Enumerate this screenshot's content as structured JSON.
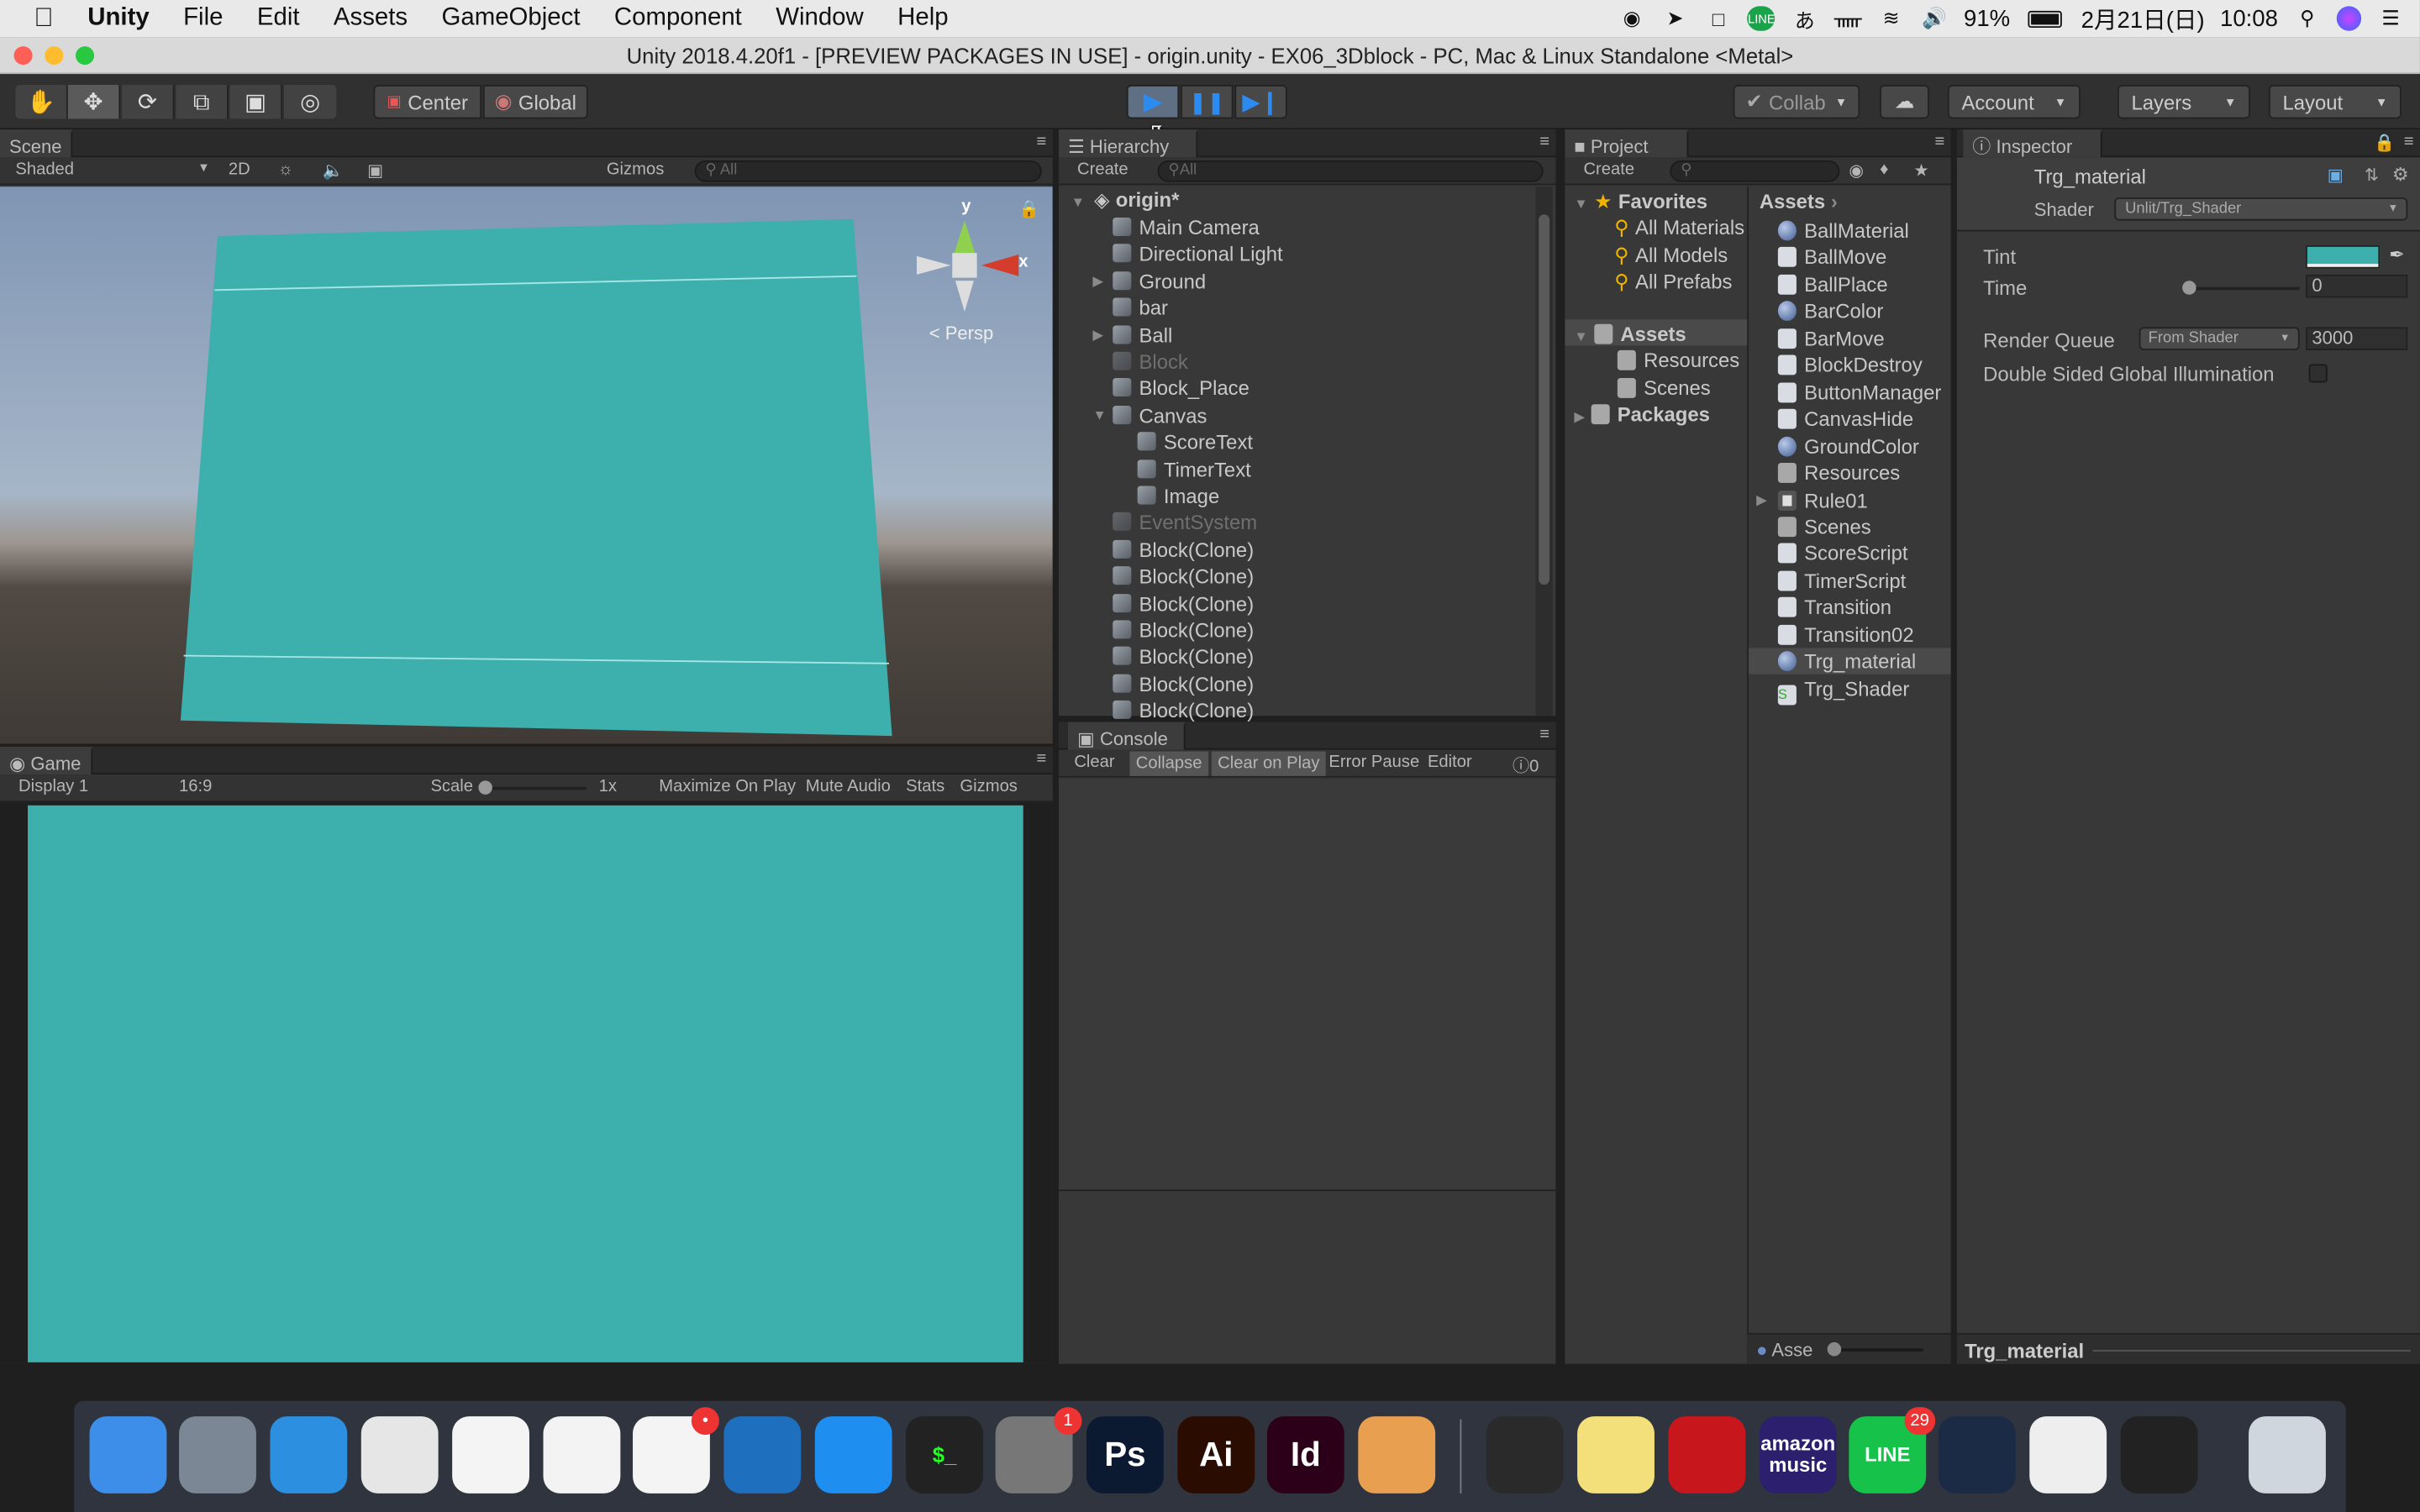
{
  "menubar": {
    "app": "Unity",
    "items": [
      "File",
      "Edit",
      "Assets",
      "GameObject",
      "Component",
      "Window",
      "Help"
    ],
    "battery": "91%",
    "date": "2月21日(日)",
    "time": "10:08",
    "ime": "あ"
  },
  "window": {
    "title": "Unity 2018.4.20f1 - [PREVIEW PACKAGES IN USE] - origin.unity - EX06_3Dblock - PC, Mac & Linux Standalone <Metal>"
  },
  "toolbar": {
    "center": "Center",
    "global": "Global",
    "collab": "Collab",
    "account": "Account",
    "layers": "Layers",
    "layout": "Layout"
  },
  "scene": {
    "tab": "Scene",
    "shading": "Shaded",
    "mode2d": "2D",
    "gizmos": "Gizmos",
    "search_placeholder": "All",
    "persp": "< Persp",
    "axis_y": "y",
    "axis_x": "x"
  },
  "game": {
    "tab": "Game",
    "display": "Display 1",
    "aspect": "16:9",
    "scale_label": "Scale",
    "scale_value": "1x",
    "maximize": "Maximize On Play",
    "mute": "Mute Audio",
    "stats": "Stats",
    "gizmos": "Gizmos"
  },
  "hierarchy": {
    "tab": "Hierarchy",
    "create": "Create",
    "search_placeholder": "All",
    "scene": "origin*",
    "items": [
      {
        "label": "Main Camera",
        "depth": 0,
        "arrow": false,
        "dim": false
      },
      {
        "label": "Directional Light",
        "depth": 0,
        "arrow": false,
        "dim": false
      },
      {
        "label": "Ground",
        "depth": 0,
        "arrow": true,
        "open": false,
        "dim": false
      },
      {
        "label": "bar",
        "depth": 0,
        "arrow": false,
        "dim": false
      },
      {
        "label": "Ball",
        "depth": 0,
        "arrow": true,
        "open": false,
        "dim": false
      },
      {
        "label": "Block",
        "depth": 0,
        "arrow": false,
        "dim": true
      },
      {
        "label": "Block_Place",
        "depth": 0,
        "arrow": false,
        "dim": false
      },
      {
        "label": "Canvas",
        "depth": 0,
        "arrow": true,
        "open": true,
        "dim": false
      },
      {
        "label": "ScoreText",
        "depth": 1,
        "arrow": false,
        "dim": false
      },
      {
        "label": "TimerText",
        "depth": 1,
        "arrow": false,
        "dim": false
      },
      {
        "label": "Image",
        "depth": 1,
        "arrow": false,
        "dim": false
      },
      {
        "label": "EventSystem",
        "depth": 0,
        "arrow": false,
        "dim": true
      },
      {
        "label": "Block(Clone)",
        "depth": 0,
        "arrow": false,
        "dim": false
      },
      {
        "label": "Block(Clone)",
        "depth": 0,
        "arrow": false,
        "dim": false
      },
      {
        "label": "Block(Clone)",
        "depth": 0,
        "arrow": false,
        "dim": false
      },
      {
        "label": "Block(Clone)",
        "depth": 0,
        "arrow": false,
        "dim": false
      },
      {
        "label": "Block(Clone)",
        "depth": 0,
        "arrow": false,
        "dim": false
      },
      {
        "label": "Block(Clone)",
        "depth": 0,
        "arrow": false,
        "dim": false
      },
      {
        "label": "Block(Clone)",
        "depth": 0,
        "arrow": false,
        "dim": false
      }
    ]
  },
  "console": {
    "tab": "Console",
    "clear": "Clear",
    "collapse": "Collapse",
    "clear_on_play": "Clear on Play",
    "error_pause": "Error Pause",
    "editor": "Editor",
    "count": "0"
  },
  "project": {
    "tab": "Project",
    "create": "Create",
    "favorites": "Favorites",
    "fav_items": [
      "All Materials",
      "All Models",
      "All Prefabs"
    ],
    "assets_root": "Assets",
    "asset_folders": [
      "Resources",
      "Scenes"
    ],
    "packages": "Packages",
    "breadcrumb": "Assets",
    "footer": "Asse",
    "assets": [
      {
        "label": "BallMaterial",
        "icon": "material"
      },
      {
        "label": "BallMove",
        "icon": "script"
      },
      {
        "label": "BallPlace",
        "icon": "script"
      },
      {
        "label": "BarColor",
        "icon": "material"
      },
      {
        "label": "BarMove",
        "icon": "script"
      },
      {
        "label": "BlockDestroy",
        "icon": "script"
      },
      {
        "label": "ButtonManager",
        "icon": "script"
      },
      {
        "label": "CanvasHide",
        "icon": "script"
      },
      {
        "label": "GroundColor",
        "icon": "material"
      },
      {
        "label": "Resources",
        "icon": "folder"
      },
      {
        "label": "Rule01",
        "icon": "prefab"
      },
      {
        "label": "Scenes",
        "icon": "folder"
      },
      {
        "label": "ScoreScript",
        "icon": "script"
      },
      {
        "label": "TimerScript",
        "icon": "script"
      },
      {
        "label": "Transition",
        "icon": "script"
      },
      {
        "label": "Transition02",
        "icon": "script"
      },
      {
        "label": "Trg_material",
        "icon": "material",
        "selected": true
      },
      {
        "label": "Trg_Shader",
        "icon": "shader"
      }
    ]
  },
  "inspector": {
    "tab": "Inspector",
    "name": "Trg_material",
    "shader_label": "Shader",
    "shader_value": "Unlit/Trg_Shader",
    "tint_label": "Tint",
    "time_label": "Time",
    "time_value": "0",
    "rq_label": "Render Queue",
    "rq_mode": "From Shader",
    "rq_value": "3000",
    "dsgi_label": "Double Sided Global Illumination",
    "footer": "Trg_material"
  },
  "colors": {
    "teal": "#3db0ae",
    "sky": "#8fa3bd"
  },
  "dock": {
    "items": [
      {
        "name": "finder-icon",
        "label": "",
        "bg": "#3c8ee8",
        "badge": ""
      },
      {
        "name": "launchpad-icon",
        "label": "",
        "bg": "#7b8794",
        "badge": ""
      },
      {
        "name": "safari-icon",
        "label": "",
        "bg": "#2d8fe0",
        "badge": ""
      },
      {
        "name": "chrome-icon",
        "label": "",
        "bg": "#e6e6e6",
        "badge": ""
      },
      {
        "name": "photos-icon",
        "label": "",
        "bg": "#f4f4f4",
        "badge": ""
      },
      {
        "name": "music-icon",
        "label": "",
        "bg": "#f3f3f3",
        "badge": ""
      },
      {
        "name": "slack-icon",
        "label": "",
        "bg": "#f4f4f4",
        "badge": "•"
      },
      {
        "name": "vscode-icon",
        "label": "",
        "bg": "#1f6fbf",
        "badge": ""
      },
      {
        "name": "appstore-icon",
        "label": "",
        "bg": "#1e8ef0",
        "badge": ""
      },
      {
        "name": "terminal-icon",
        "label": "$_",
        "bg": "#222",
        "badge": ""
      },
      {
        "name": "system-preferences-icon",
        "label": "",
        "bg": "#777",
        "badge": "1"
      },
      {
        "name": "photoshop-icon",
        "label": "Ps",
        "bg": "#0b1a30",
        "badge": ""
      },
      {
        "name": "illustrator-icon",
        "label": "Ai",
        "bg": "#2a0d00",
        "badge": ""
      },
      {
        "name": "indesign-icon",
        "label": "Id",
        "bg": "#2b0018",
        "badge": ""
      },
      {
        "name": "cookie-app-icon",
        "label": "",
        "bg": "#e8a050",
        "badge": ""
      },
      {
        "name": "activity-monitor-icon",
        "label": "",
        "bg": "#2a2a2a",
        "badge": ""
      },
      {
        "name": "stickies-icon",
        "label": "",
        "bg": "#f3e07a",
        "badge": ""
      },
      {
        "name": "acrobat-icon",
        "label": "",
        "bg": "#c8161d",
        "badge": ""
      },
      {
        "name": "amazon-music-icon",
        "label": "amazon music",
        "bg": "#2b1f6e",
        "badge": ""
      },
      {
        "name": "line-icon",
        "label": "LINE",
        "bg": "#16c24a",
        "badge": "29"
      },
      {
        "name": "steam-icon",
        "label": "",
        "bg": "#1b2a45",
        "badge": ""
      },
      {
        "name": "unity-hub-icon",
        "label": "",
        "bg": "#eee",
        "badge": ""
      },
      {
        "name": "unity-icon",
        "label": "",
        "bg": "#222",
        "badge": ""
      },
      {
        "name": "trash-icon",
        "label": "",
        "bg": "#cfd6de",
        "badge": ""
      }
    ]
  }
}
